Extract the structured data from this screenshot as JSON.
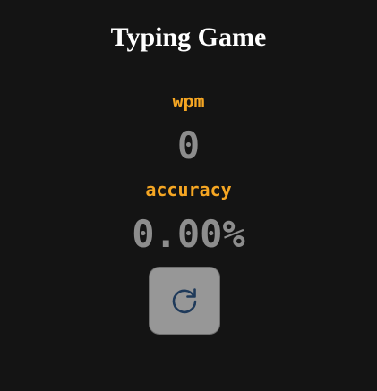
{
  "header": {
    "title": "Typing Game"
  },
  "stats": {
    "wpm_label": "wpm",
    "wpm_value": "0",
    "accuracy_label": "accuracy",
    "accuracy_value": "0.00%"
  },
  "controls": {
    "reset_icon": "refresh-icon"
  },
  "colors": {
    "background": "#141414",
    "label": "#f5a623",
    "value": "#8d8d8d",
    "button": "#979797",
    "icon": "#1f3a5a"
  }
}
